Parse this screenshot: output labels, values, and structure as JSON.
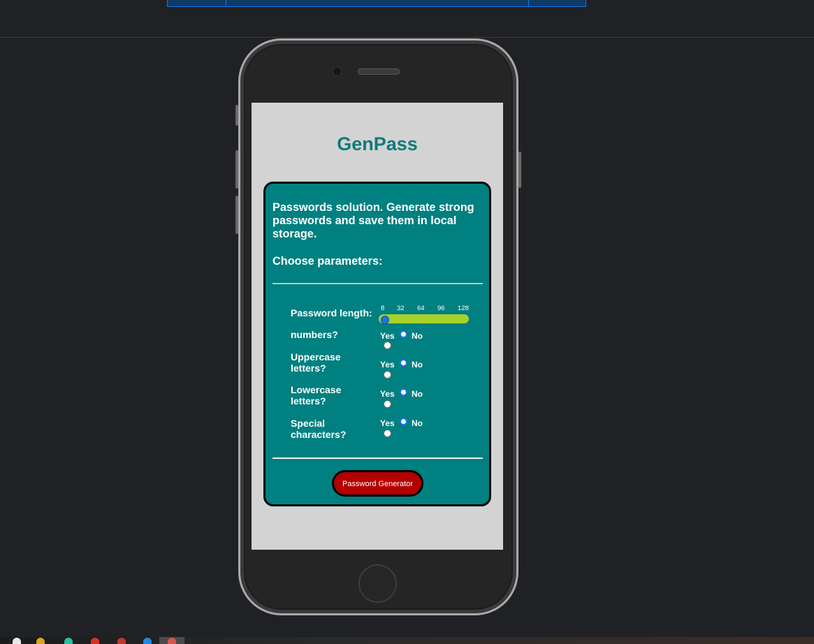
{
  "app": {
    "title": "GenPass",
    "intro": "Passwords solution. Generate strong passwords and save them in local storage.",
    "choose_heading": "Choose parameters:"
  },
  "params": {
    "length_label": "Password length:",
    "length_ticks": [
      "8",
      "32",
      "64",
      "96",
      "128"
    ],
    "length_min": 8,
    "length_max": 128,
    "length_value": 8,
    "options": [
      {
        "label": "numbers?",
        "yes": "Yes",
        "no": "No",
        "selected": "No"
      },
      {
        "label": "Uppercase letters?",
        "yes": "Yes",
        "no": "No",
        "selected": "No"
      },
      {
        "label": "Lowercase letters?",
        "yes": "Yes",
        "no": "No",
        "selected": "No"
      },
      {
        "label": "Special characters?",
        "yes": "Yes",
        "no": "No",
        "selected": "No"
      }
    ]
  },
  "button": {
    "label": "Password Generator"
  },
  "colors": {
    "card": "#008080",
    "title": "#0f7a7d",
    "button": "#b30000",
    "slider": "#a6d22a",
    "accent": "#1a73e8"
  }
}
